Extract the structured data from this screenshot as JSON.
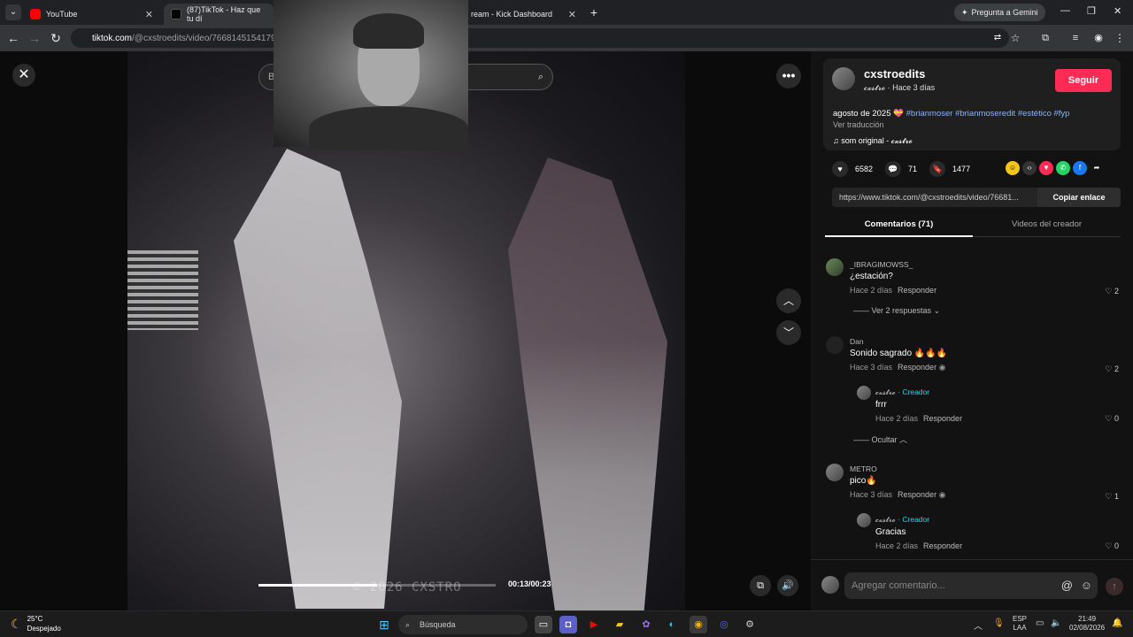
{
  "browser": {
    "tabs": [
      {
        "label": "YouTube"
      },
      {
        "label": "(87)TikTok - Haz que tu dí"
      },
      {
        "label": "ream - Kick Dashboard"
      }
    ],
    "url_domain": "tiktok.com",
    "url_path": "/@cxstroedits/video/766814515417951",
    "gemini_label": "Pregunta a Gemini"
  },
  "viewer": {
    "search_placeholder": "B",
    "time": "00:13/00:23",
    "progress_fraction": 0.5,
    "watermark": "© 2026 CXSTRO"
  },
  "post": {
    "author": "cxstroedits",
    "author_sub": "𝓬𝔁𝓼𝓽𝓻𝓸 · Hace 3 días",
    "follow_label": "Seguir",
    "desc_text": "agosto de 2025 💝",
    "desc_tags": "#brianmoser #brianmoseredit #estético #fyp",
    "translate": "Ver traducción",
    "music": "som original - 𝓬𝔁𝓼𝓽𝓻𝓸",
    "likes": "6582",
    "comments": "71",
    "saves": "1477",
    "link": "https://www.tiktok.com/@cxstroedits/video/76681...",
    "copy_label": "Copiar enlace"
  },
  "tabs": {
    "comments_label": "Comentarios (71)",
    "videos_label": "Videos del creador"
  },
  "comments": [
    {
      "user": "_IBRAGIMOWSS_",
      "text": "¿estación?",
      "time": "Hace 2 días",
      "reply": "Responder",
      "likes": "2",
      "more": "Ver 2 respuestas"
    },
    {
      "user": "Dan",
      "text": "Sonido sagrado 🔥🔥🔥",
      "time": "Hace 3 días",
      "reply": "Responder",
      "likes": "2"
    },
    {
      "user": "𝓬𝔁𝓼𝓽𝓻𝓸",
      "creator": "· Creador",
      "text": "frrr",
      "time": "Hace 2 días",
      "reply": "Responder",
      "likes": "0",
      "more": "Ocultar"
    },
    {
      "user": "METRO",
      "text": "pico🔥",
      "time": "Hace 3 días",
      "reply": "Responder",
      "likes": "1"
    },
    {
      "user": "𝓬𝔁𝓼𝓽𝓻𝓸",
      "creator": "· Creador",
      "text": "Gracias",
      "time": "Hace 2 días",
      "reply": "Responder",
      "likes": "0"
    }
  ],
  "comment_input": {
    "placeholder": "Agregar comentario..."
  },
  "taskbar": {
    "temp": "25°C",
    "weather": "Despejado",
    "search": "Búsqueda",
    "lang1": "ESP",
    "lang2": "LAA",
    "time": "21:49",
    "date": "02/08/2026"
  },
  "colors": {
    "accent": "#fe2c55",
    "creator": "#20d5ec",
    "tags": "#8ab4f8"
  }
}
